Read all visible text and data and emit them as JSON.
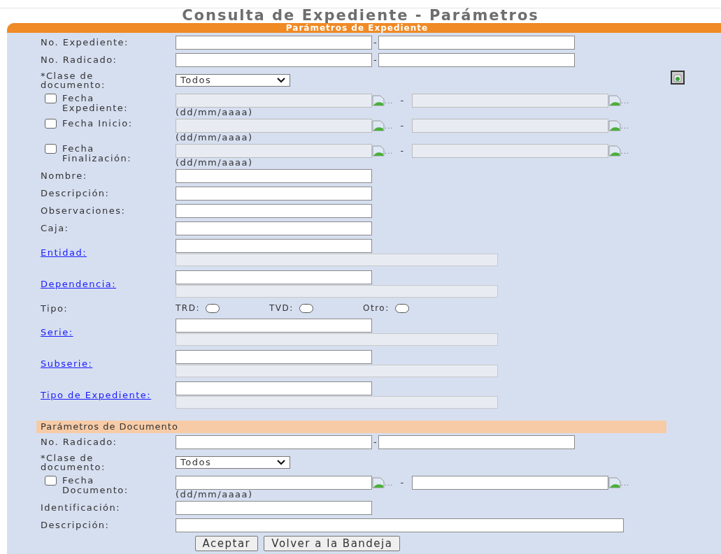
{
  "title": "Consulta de Expediente - Parámetros",
  "expediente_section": {
    "title": "Parámetros de Expediente",
    "rows": [
      {
        "kind": "pair",
        "label": "No. Expediente:",
        "separator": "-"
      },
      {
        "kind": "pair",
        "label": "No. Radicado:",
        "separator": "-"
      },
      {
        "kind": "select",
        "label": "*Clase de documento:",
        "value": "Todos",
        "action_button": true
      },
      {
        "kind": "date",
        "label": "Fecha Expediente:",
        "checked": false,
        "disabled": true,
        "format": "(dd/mm/aaaa)",
        "separator": "-",
        "start_icon_text": "...",
        "end_icon_text": "..."
      },
      {
        "kind": "date",
        "label": "Fecha Inicio:",
        "checked": false,
        "disabled": true,
        "format": "(dd/mm/aaaa)",
        "separator": "-",
        "start_icon_text": "...",
        "end_icon_text": "..."
      },
      {
        "kind": "date",
        "label": "Fecha Finalización:",
        "checked": false,
        "disabled": true,
        "format": "(dd/mm/aaaa)",
        "separator": "-",
        "start_icon_text": "...",
        "end_icon_text": "..."
      },
      {
        "kind": "text",
        "label": "Nombre:",
        "wide": false
      },
      {
        "kind": "text",
        "label": "Descripción:",
        "wide": false
      },
      {
        "kind": "text",
        "label": "Observaciones:",
        "wide": false
      },
      {
        "kind": "text",
        "label": "Caja:",
        "wide": false
      },
      {
        "kind": "lookup",
        "label": "Entidad:"
      },
      {
        "kind": "lookup",
        "label": "Dependencia:"
      },
      {
        "kind": "radio",
        "label": "Tipo:",
        "options": [
          {
            "label": "TRD:",
            "selected": false
          },
          {
            "label": "TVD:",
            "selected": false
          },
          {
            "label": "Otro:",
            "selected": false
          }
        ]
      },
      {
        "kind": "lookup",
        "label": "Serie:"
      },
      {
        "kind": "lookup",
        "label": "Subserie:"
      },
      {
        "kind": "lookup",
        "label": "Tipo de Expediente:"
      }
    ]
  },
  "documento_section": {
    "title": "Parámetros de Documento",
    "rows": [
      {
        "kind": "pair",
        "label": "No. Radicado:",
        "separator": "-"
      },
      {
        "kind": "select",
        "label": "*Clase de documento:",
        "value": "Todos",
        "action_button": false
      },
      {
        "kind": "date",
        "label": "Fecha Documento:",
        "checked": false,
        "disabled": false,
        "format": "(dd/mm/aaaa)",
        "separator": "-",
        "start_icon_text": "...",
        "end_icon_text": "..."
      },
      {
        "kind": "text",
        "label": "Identificación:",
        "wide": false
      },
      {
        "kind": "text",
        "label": "Descripción:",
        "wide": true
      }
    ]
  },
  "buttons": [
    {
      "label": "Aceptar"
    },
    {
      "label": "Volver a la Bandeja"
    }
  ]
}
